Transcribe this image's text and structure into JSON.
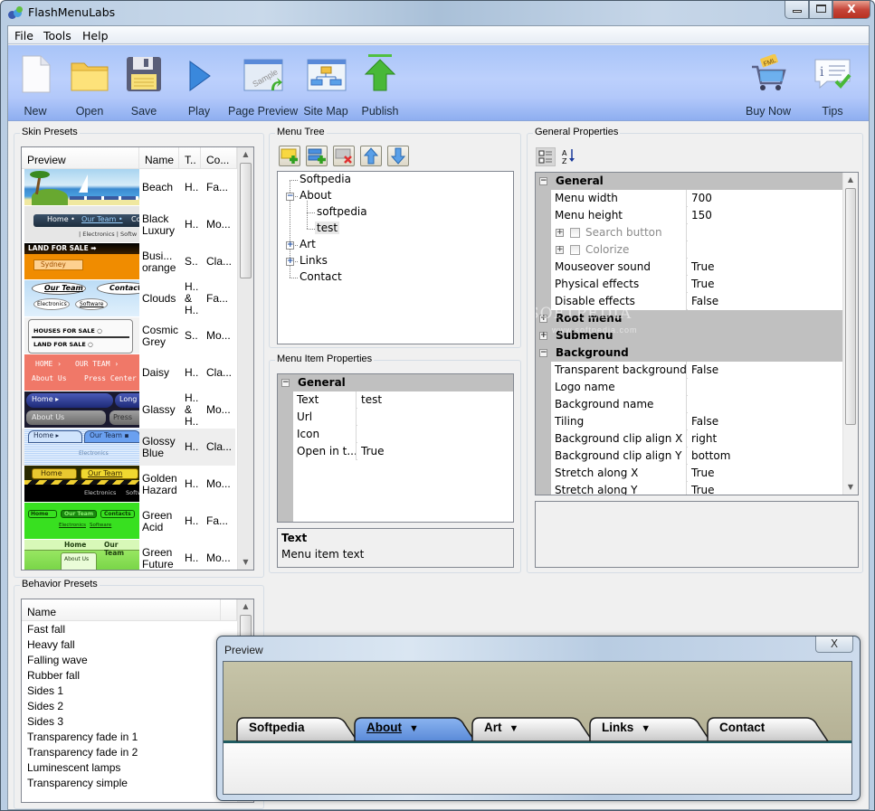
{
  "window": {
    "title": "FlashMenuLabs",
    "controls": {
      "minimize": "–",
      "maximize": "▫",
      "close": "X"
    }
  },
  "menubar": {
    "items": [
      "File",
      "Tools",
      "Help"
    ]
  },
  "toolbar": {
    "buttons": [
      {
        "label": "New",
        "icon": "new-document-icon"
      },
      {
        "label": "Open",
        "icon": "folder-open-icon"
      },
      {
        "label": "Save",
        "icon": "floppy-save-icon"
      },
      {
        "label": "Play",
        "icon": "play-icon"
      },
      {
        "label": "Page Preview",
        "icon": "page-preview-icon",
        "badge": "Sample"
      },
      {
        "label": "Site Map",
        "icon": "site-map-icon"
      },
      {
        "label": "Publish",
        "icon": "publish-upload-icon"
      },
      {
        "label": "Buy Now",
        "icon": "shopping-cart-icon",
        "badge": "FML"
      },
      {
        "label": "Tips",
        "icon": "tips-info-icon"
      }
    ]
  },
  "skin_presets": {
    "title": "Skin Presets",
    "columns": [
      "Preview",
      "Name",
      "T..",
      "Co..."
    ],
    "rows": [
      {
        "name": "Beach",
        "type": "H..",
        "color": "Fa..."
      },
      {
        "name": "Black Luxury",
        "type": "H..",
        "color": "Mo..."
      },
      {
        "name": "Busi... orange",
        "type": "S..",
        "color": "Cla..."
      },
      {
        "name": "Clouds",
        "type": "H.. & H..",
        "color": "Fa..."
      },
      {
        "name": "Cosmic Grey",
        "type": "S..",
        "color": "Mo..."
      },
      {
        "name": "Daisy",
        "type": "H..",
        "color": "Cla..."
      },
      {
        "name": "Glassy",
        "type": "H.. & H..",
        "color": "Mo..."
      },
      {
        "name": "Glossy Blue",
        "type": "H..",
        "color": "Cla...",
        "selected": true
      },
      {
        "name": "Golden Hazard",
        "type": "H..",
        "color": "Mo..."
      },
      {
        "name": "Green Acid",
        "type": "H..",
        "color": "Fa..."
      },
      {
        "name": "Green Future",
        "type": "H..",
        "color": "Mo..."
      }
    ],
    "preview_texts": {
      "black_luxury": [
        "Home •",
        "Our Team •",
        "Co",
        "| Electronics | Softw"
      ],
      "busi_orange": [
        "LAND FOR SALE ➡",
        "Sydney"
      ],
      "clouds": [
        "Our Team",
        "Contact",
        "Electronics",
        "Software"
      ],
      "cosmic_grey": [
        "HOUSES FOR SALE ○",
        "LAND FOR SALE ○"
      ],
      "daisy": [
        "HOME ›",
        "OUR TEAM ›",
        "About Us",
        "Press Center"
      ],
      "glassy": [
        "Home ▸",
        "Long",
        "About Us",
        "Press"
      ],
      "glossy_blue": [
        "Home ▸",
        "Our Team ▪",
        "Electronics"
      ],
      "golden_hazard": [
        "Home",
        "Our Team",
        "Electronics",
        "Softw"
      ],
      "green_acid": [
        "Home",
        "Our Team",
        "Contacts",
        "Electronics",
        "Software"
      ],
      "green_future": [
        "Home",
        "Our Team",
        "About Us"
      ]
    }
  },
  "behavior_presets": {
    "title": "Behavior Presets",
    "columns": [
      "Name"
    ],
    "items": [
      "Fast fall",
      "Heavy fall",
      "Falling wave",
      "Rubber fall",
      "Sides 1",
      "Sides 2",
      "Sides 3",
      "Transparency fade in 1",
      "Transparency fade in 2",
      "Luminescent lamps",
      "Transparency simple"
    ]
  },
  "menu_tree": {
    "title": "Menu Tree",
    "tools": [
      {
        "name": "add-item-icon",
        "tooltip": "Add item"
      },
      {
        "name": "add-subitem-icon",
        "tooltip": "Add sub item"
      },
      {
        "name": "delete-item-icon",
        "tooltip": "Delete"
      },
      {
        "name": "move-up-icon",
        "tooltip": "Move up"
      },
      {
        "name": "move-down-icon",
        "tooltip": "Move down"
      }
    ],
    "nodes": [
      {
        "label": "Softpedia",
        "level": 0
      },
      {
        "label": "About",
        "level": 0,
        "expander": "−"
      },
      {
        "label": "softpedia",
        "level": 1
      },
      {
        "label": "test",
        "level": 1,
        "selected": true
      },
      {
        "label": "Art",
        "level": 0,
        "expander": "+"
      },
      {
        "label": "Links",
        "level": 0,
        "expander": "+"
      },
      {
        "label": "Contact",
        "level": 0
      }
    ]
  },
  "menu_item_properties": {
    "title": "Menu Item Properties",
    "category": "General",
    "rows": [
      {
        "name": "Text",
        "value": "test"
      },
      {
        "name": "Url",
        "value": ""
      },
      {
        "name": "Icon",
        "value": ""
      },
      {
        "name": "Open in t...",
        "value": "True"
      }
    ],
    "help": {
      "title": "Text",
      "description": "Menu item text"
    }
  },
  "general_properties": {
    "title": "General Properties",
    "view_buttons": [
      "categorized-view-icon",
      "alphabetical-sort-icon"
    ],
    "items": [
      {
        "kind": "cat",
        "label": "General",
        "expander": "−"
      },
      {
        "kind": "row",
        "name": "Menu width",
        "value": "700"
      },
      {
        "kind": "row",
        "name": "Menu height",
        "value": "150"
      },
      {
        "kind": "check",
        "name": "Search button",
        "value": ""
      },
      {
        "kind": "check",
        "name": "Colorize",
        "value": ""
      },
      {
        "kind": "row",
        "name": "Mouseover sound",
        "value": "True"
      },
      {
        "kind": "row",
        "name": "Physical effects",
        "value": "True"
      },
      {
        "kind": "row",
        "name": "Disable effects",
        "value": "False"
      },
      {
        "kind": "cat",
        "label": "Root menu",
        "expander": "+"
      },
      {
        "kind": "cat",
        "label": "Submenu",
        "expander": "+"
      },
      {
        "kind": "cat",
        "label": "Background",
        "expander": "−"
      },
      {
        "kind": "row",
        "name": "Transparent background",
        "value": "False"
      },
      {
        "kind": "row",
        "name": "Logo name",
        "value": ""
      },
      {
        "kind": "row",
        "name": "Background name",
        "value": ""
      },
      {
        "kind": "row",
        "name": "Tiling",
        "value": "False"
      },
      {
        "kind": "row",
        "name": "Background clip align X",
        "value": "right"
      },
      {
        "kind": "row",
        "name": "Background clip align Y",
        "value": "bottom"
      },
      {
        "kind": "row",
        "name": "Stretch along X",
        "value": "True"
      },
      {
        "kind": "row",
        "name": "Stretch along Y",
        "value": "True"
      }
    ],
    "watermark": "SOFTPEDIA",
    "watermark_url": "www.softpedia.com"
  },
  "preview": {
    "title": "Preview",
    "close": "X",
    "tabs": [
      {
        "label": "Softpedia",
        "arrow": false,
        "active": false
      },
      {
        "label": "About",
        "arrow": true,
        "active": true
      },
      {
        "label": "Art",
        "arrow": true,
        "active": false
      },
      {
        "label": "Links",
        "arrow": true,
        "active": false
      },
      {
        "label": "Contact",
        "arrow": false,
        "active": false
      }
    ],
    "arrow_glyph": "🡇"
  },
  "colors": {
    "toolbar_top": "#a8c4f8",
    "active_tab": "#6e9ae0",
    "preview_bg": "#c6c4a8",
    "preview_line": "#1e5a60",
    "category_gray": "#c0c0c0"
  }
}
